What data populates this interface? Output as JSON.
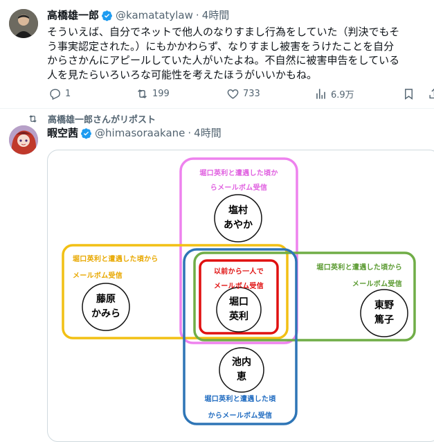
{
  "tweet1": {
    "author_name": "高橋雄一郎",
    "handle": "@kamatatylaw",
    "dot": "·",
    "time": "4時間",
    "lines": [
      "そういえば、自分でネットで他人のなりすまし行為をしていた（判決でもそ",
      "う事実認定された。）にもかかわらず、なりすまし被害をうけたことを自分",
      "からさかんにアピールしていた人がいたよね。不自然に被害申告をしている",
      "人を見たらいろいろな可能性を考えたほうがいいかもね。"
    ],
    "replies": "1",
    "reposts": "199",
    "likes": "733",
    "views": "6.9万"
  },
  "repost_label": "高橋雄一郎さんがリポスト",
  "tweet2": {
    "author_name": "暇空茜",
    "handle": "@himasoraakane",
    "dot": "·",
    "time": "4時間"
  },
  "diagram": {
    "top_label_lines": [
      "堀口英利と遭遇した頃か",
      "らメールボム受信"
    ],
    "top_name_lines": [
      "塩村",
      "あやか"
    ],
    "left_label_lines": [
      "堀口英利と遭遇した頃から",
      "メールボム受信"
    ],
    "left_name_lines": [
      "藤原",
      "かみら"
    ],
    "right_label_lines": [
      "堀口英利と遭遇した頃から",
      "メールボム受信"
    ],
    "right_name_lines": [
      "東野",
      "篤子"
    ],
    "center_label_lines": [
      "以前から一人で",
      "メールボム受信"
    ],
    "center_name_lines": [
      "堀口",
      "英利"
    ],
    "bottom_label_lines": [
      "堀口英利と遭遇した頃",
      "からメールボム受信"
    ],
    "bottom_name_lines": [
      "池内",
      "恵"
    ]
  },
  "colors": {
    "brand_blue": "#1d9bf0",
    "pink": "#ee82ee",
    "orange": "#f2c014",
    "green": "#70ad47",
    "blue": "#2e75b6",
    "red": "#e01010",
    "pink_text": "#e060e0",
    "orange_text": "#e8a800",
    "green_text": "#5a9a30",
    "blue_text": "#1f6bc0",
    "red_text": "#e01010"
  },
  "icons": [
    "reply-icon",
    "repost-icon",
    "like-icon",
    "views-icon",
    "bookmark-icon",
    "verified-icon",
    "repost-small-icon"
  ]
}
